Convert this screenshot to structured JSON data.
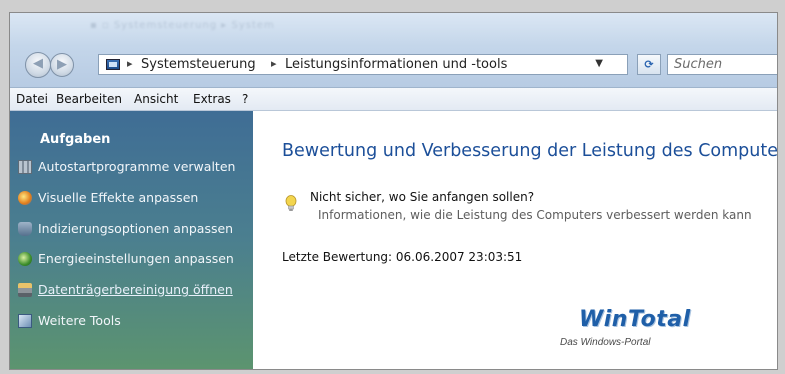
{
  "window": {
    "title_blurred": "▪ ▫ Systemsteuerung ▸ System"
  },
  "nav": {
    "back_glyph": "◀",
    "forward_glyph": "▶"
  },
  "address": {
    "segments": [
      "Systemsteuerung",
      "Leistungsinformationen und -tools"
    ],
    "separator": "▸",
    "dropdown_glyph": "▼"
  },
  "refresh": {
    "glyph": "⟳"
  },
  "search": {
    "placeholder": "Suchen"
  },
  "menu": {
    "items": [
      "Datei",
      "Bearbeiten",
      "Ansicht",
      "Extras",
      "?"
    ]
  },
  "sidebar": {
    "title": "Aufgaben",
    "items": [
      {
        "label": "Autostartprogramme verwalten",
        "icon": "autostart-icon",
        "link": false
      },
      {
        "label": "Visuelle Effekte anpassen",
        "icon": "visual-effects-icon",
        "link": false
      },
      {
        "label": "Indizierungsoptionen anpassen",
        "icon": "indexing-icon",
        "link": false
      },
      {
        "label": "Energieeinstellungen anpassen",
        "icon": "power-icon",
        "link": false
      },
      {
        "label": "Datenträgerbereinigung öffnen",
        "icon": "disk-cleanup-icon",
        "link": true
      },
      {
        "label": "Weitere Tools",
        "icon": "tools-icon",
        "link": false
      }
    ]
  },
  "main": {
    "title": "Bewertung und Verbesserung der Leistung des Computers",
    "tip_title": "Nicht sicher, wo Sie anfangen sollen?",
    "tip_text": "Informationen, wie die Leistung des Computers verbessert werden kann",
    "last_rating": "Letzte Bewertung: 06.06.2007 23:03:51"
  },
  "watermark": {
    "logo": "WinTotal",
    "tagline": "Das Windows-Portal"
  },
  "colors": {
    "title_blue": "#1c4f99",
    "sidebar_top": "#3f6d95",
    "sidebar_bottom": "#5c946f",
    "logo_blue": "#1f5fa8"
  }
}
